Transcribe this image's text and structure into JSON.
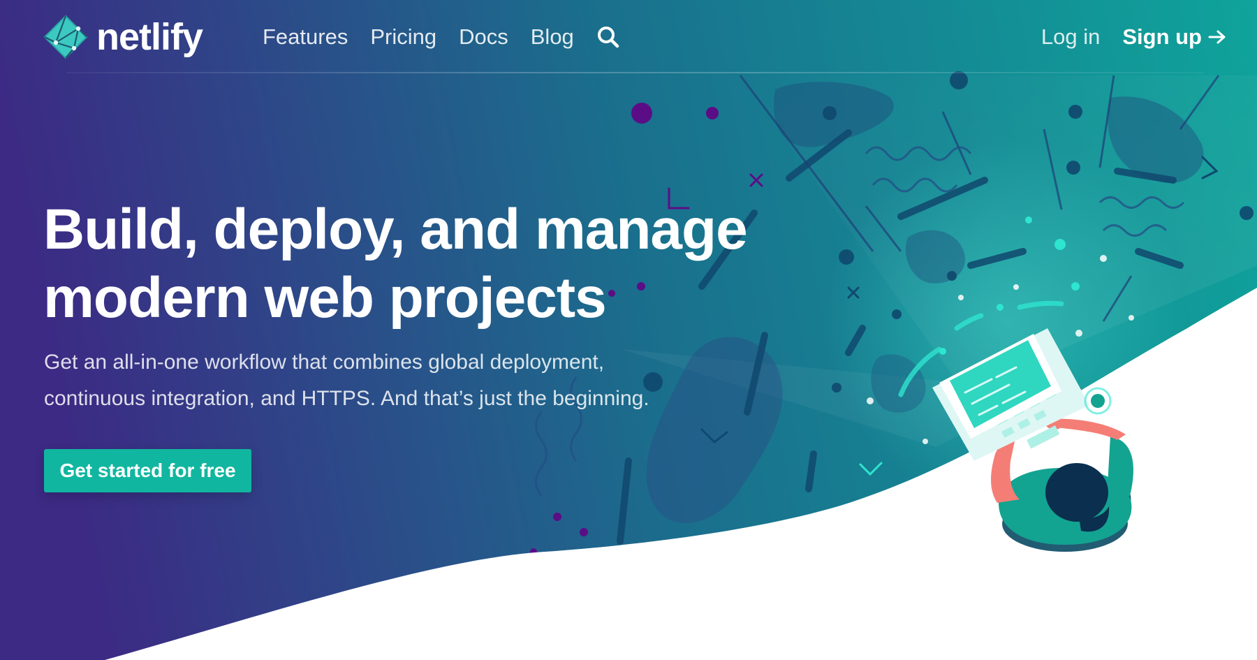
{
  "brand": {
    "name": "netlify",
    "logo_icon": "netlify-diamond-icon"
  },
  "nav": {
    "links": [
      {
        "label": "Features"
      },
      {
        "label": "Pricing"
      },
      {
        "label": "Docs"
      },
      {
        "label": "Blog"
      }
    ],
    "search_icon": "search-icon",
    "login_label": "Log in",
    "signup_label": "Sign up",
    "signup_arrow": "→"
  },
  "hero": {
    "headline": "Build, deploy, and manage modern web projects",
    "subhead": "Get an all-in-one workflow that combines global deployment, continuous integration, and HTTPS. And that’s just the beginning.",
    "cta_label": "Get started for free",
    "illustration": "developer-at-laptop-illustration"
  },
  "colors": {
    "gradient_start": "#3c2a84",
    "gradient_end": "#0f9a98",
    "cta": "#11b6a0",
    "accent_teal": "#2ee5cf",
    "accent_purple": "#5b0d86",
    "background": "#ffffff"
  }
}
